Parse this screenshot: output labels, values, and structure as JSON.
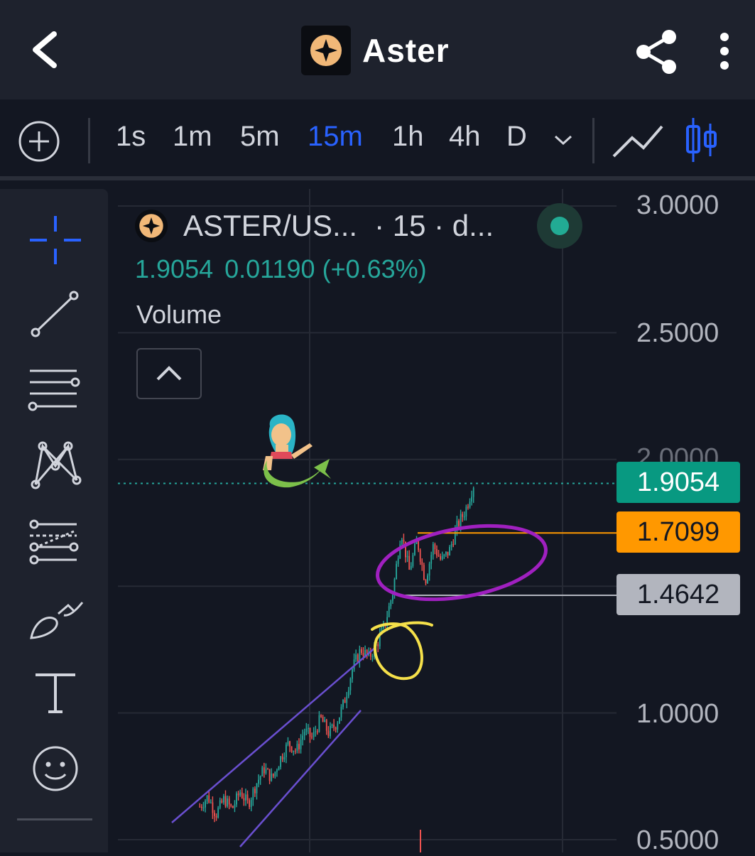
{
  "header": {
    "title": "Aster"
  },
  "timeframes": {
    "items": [
      "1s",
      "1m",
      "5m",
      "15m",
      "1h",
      "4h",
      "D"
    ],
    "active": "15m"
  },
  "legend": {
    "symbol": "ASTER/US...",
    "interval": "· 15 · d...",
    "last_price": "1.9054",
    "change": "0.01190",
    "change_pct": "(+0.63%)",
    "volume_label": "Volume",
    "status_color": "#22ab94"
  },
  "price_axis": {
    "ticks": [
      "3.0000",
      "2.5000",
      "2.0000",
      "1.0000",
      "0.5000"
    ]
  },
  "price_tags": {
    "current": "1.9054",
    "current_color": "#089981",
    "orange": "1.7099",
    "orange_color": "#ff9800",
    "gray": "1.4642",
    "gray_color": "#b2b5be"
  },
  "chart_data": {
    "type": "candlestick",
    "symbol": "ASTER/USD",
    "interval": "15",
    "ylim": [
      0.5,
      3.0
    ],
    "y_ticks": [
      0.5,
      1.0,
      2.0,
      2.5,
      3.0
    ],
    "last_price": 1.9054,
    "horizontal_lines": [
      1.9054,
      1.7099,
      1.4642
    ],
    "approx_close_path": [
      0.63,
      0.67,
      0.6,
      0.66,
      0.62,
      0.69,
      0.64,
      0.72,
      0.78,
      0.74,
      0.82,
      0.88,
      0.85,
      0.93,
      0.9,
      0.98,
      0.92,
      0.96,
      1.05,
      1.18,
      1.25,
      1.22,
      1.27,
      1.35,
      1.48,
      1.72,
      1.56,
      1.68,
      1.52,
      1.66,
      1.6,
      1.64,
      1.74,
      1.8,
      1.9
    ]
  },
  "icons": {
    "back": "chevron-left-icon",
    "share": "share-icon",
    "more": "more-vertical-icon",
    "add": "plus-circle-icon",
    "dropdown": "chevron-down-icon",
    "line_chart": "line-chart-icon",
    "candle_chart": "candle-chart-icon",
    "tools": [
      "crosshair-icon",
      "trend-line-icon",
      "horizontal-lines-icon",
      "pattern-icon",
      "fib-icon",
      "brush-icon",
      "text-icon",
      "emoji-icon"
    ]
  }
}
